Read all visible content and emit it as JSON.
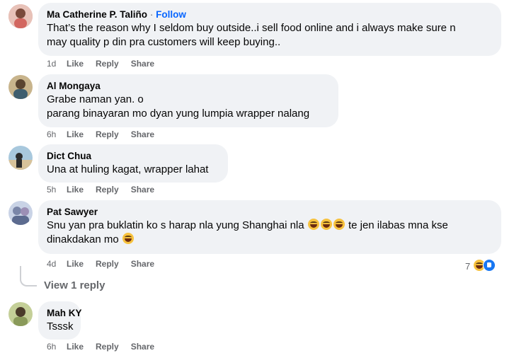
{
  "comments": [
    {
      "name": "Ma Catherine P. Taliño",
      "separator": "·",
      "follow": "Follow",
      "lines": [
        "That’s the reason why I seldom buy outside..i sell food online and i always make sure n",
        "may quality p din pra customers will keep buying.."
      ],
      "time": "1d",
      "like": "Like",
      "reply": "Reply",
      "share": "Share",
      "avatar_color": "#d98a8f"
    },
    {
      "name": "Al Mongaya",
      "lines": [
        "Grabe naman yan. o",
        "parang binayaran mo dyan yung lumpia wrapper nalang"
      ],
      "time": "6h",
      "like": "Like",
      "reply": "Reply",
      "share": "Share",
      "avatar_color": "#b9a27a"
    },
    {
      "name": "Dict Chua",
      "lines": [
        "Una at huling kagat, wrapper lahat"
      ],
      "time": "5h",
      "like": "Like",
      "reply": "Reply",
      "share": "Share",
      "avatar_color": "#8fb3c9"
    },
    {
      "name": "Pat Sawyer",
      "line1_a": "Snu yan pra buklatin ko s harap nla yung Shanghai nla",
      "line1_b": "te jen ilabas mna kse",
      "line2": "dinakdakan mo",
      "time": "4d",
      "like": "Like",
      "reply": "Reply",
      "share": "Share",
      "reaction_count": "7",
      "avatar_color": "#a7b6cf"
    },
    {
      "name": "Mah KY",
      "lines": [
        "Tsssk"
      ],
      "time": "6h",
      "like": "Like",
      "reply": "Reply",
      "share": "Share",
      "avatar_color": "#9aa46e"
    }
  ],
  "view_reply": "View 1 reply",
  "icons": {
    "laughing_emoji": "laughing-emoji",
    "like_reaction": "like-reaction-icon",
    "avatar": "profile-photo"
  },
  "colors": {
    "bubble": "#f0f2f5",
    "meta_text": "#65676b",
    "follow": "#0866ff",
    "like_blue": "#1877f2"
  }
}
